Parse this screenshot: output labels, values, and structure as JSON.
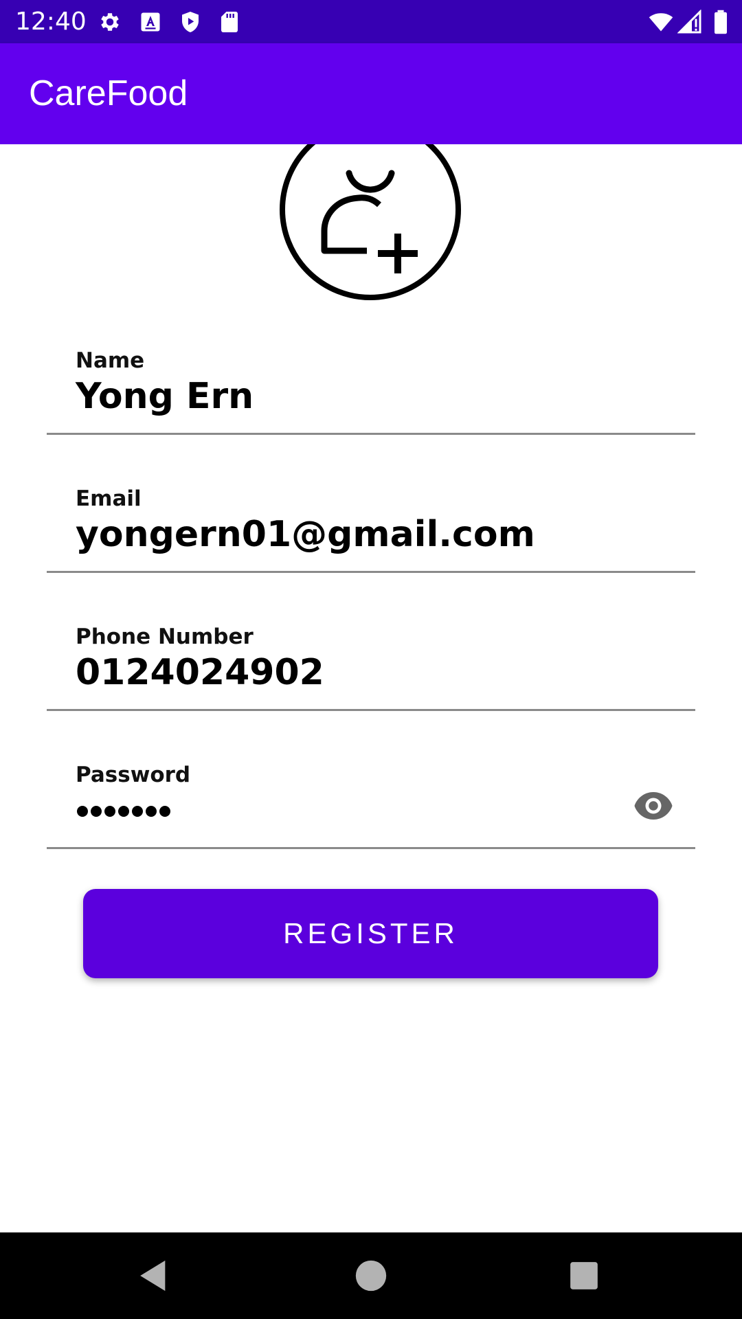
{
  "status_bar": {
    "time": "12:40",
    "left_icons": [
      "gear-icon",
      "a-keyboard-icon",
      "shield-play-icon",
      "sd-card-icon"
    ],
    "right_icons": [
      "wifi-icon",
      "cell-signal-icon",
      "battery-icon"
    ]
  },
  "app_bar": {
    "title": "CareFood"
  },
  "avatar": {
    "icon": "add-user-icon"
  },
  "form": {
    "name": {
      "label": "Name",
      "value": "Yong Ern"
    },
    "email": {
      "label": "Email",
      "value": "yongern01@gmail.com"
    },
    "phone": {
      "label": "Phone Number",
      "value": "0124024902"
    },
    "password": {
      "label": "Password",
      "masked_length": 7,
      "toggle_icon": "eye-icon"
    }
  },
  "register_button": {
    "label": "REGISTER"
  },
  "colors": {
    "status_bar": "#3700b3",
    "app_bar": "#6200ee",
    "button": "#5b00dd",
    "nav_bar": "#000000"
  },
  "nav_bar": {
    "buttons": [
      "back-icon",
      "home-icon",
      "recents-icon"
    ]
  }
}
